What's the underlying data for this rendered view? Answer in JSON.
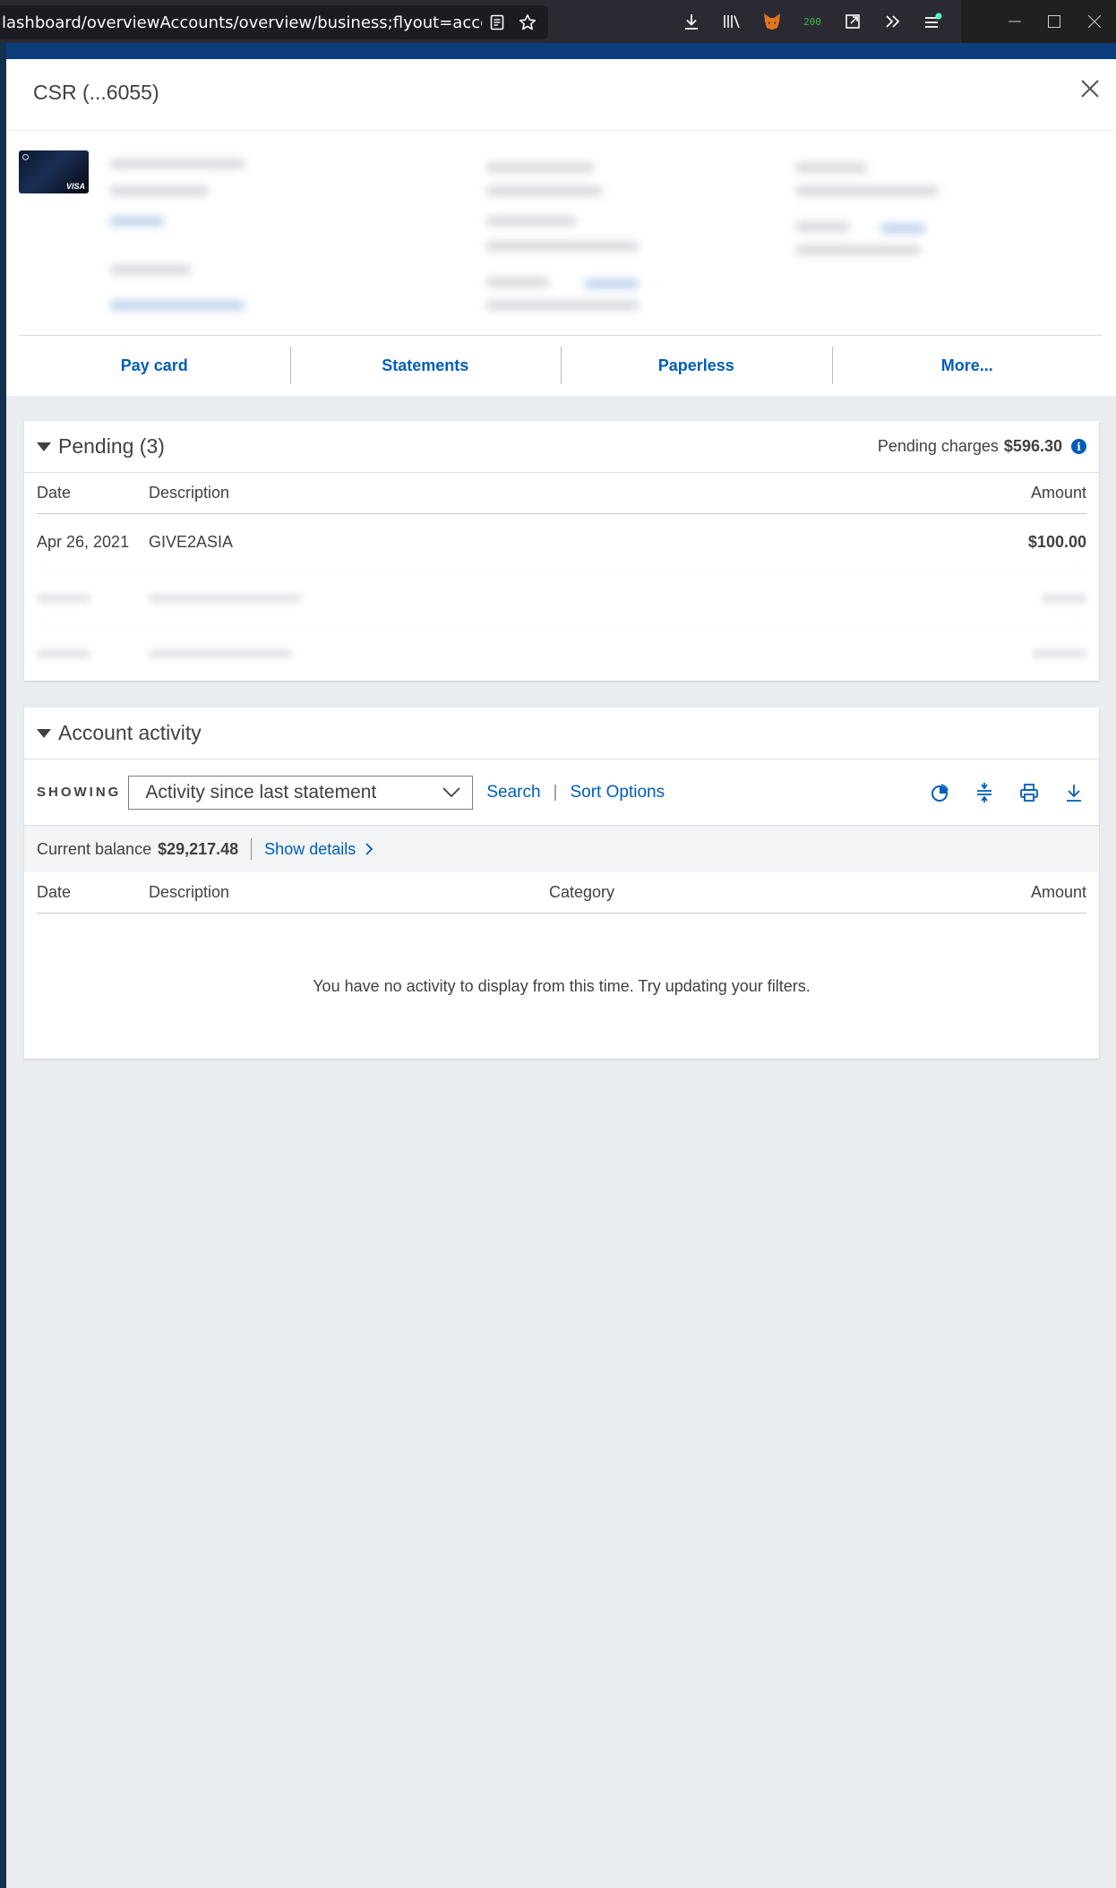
{
  "browser": {
    "url": "lashboard/overviewAccounts/overview/business;flyout=accountSummary",
    "ext_badge": "200"
  },
  "flyout": {
    "title": "CSR (...6055)",
    "card_brand": "VISA"
  },
  "actions": [
    {
      "label": "Pay card"
    },
    {
      "label": "Statements"
    },
    {
      "label": "Paperless"
    },
    {
      "label": "More..."
    }
  ],
  "pending": {
    "title": "Pending (3)",
    "charges_label": "Pending charges",
    "charges_amount": "$596.30",
    "columns": {
      "date": "Date",
      "description": "Description",
      "amount": "Amount"
    },
    "rows": [
      {
        "date": "Apr 26, 2021",
        "description": "GIVE2ASIA",
        "amount": "$100.00"
      }
    ]
  },
  "activity": {
    "title": "Account activity",
    "showing_label": "SHOWING",
    "filter_selected": "Activity since last statement",
    "search_label": "Search",
    "sort_label": "Sort Options",
    "balance_label": "Current balance",
    "balance_amount": "$29,217.48",
    "show_details_label": "Show details",
    "columns": {
      "date": "Date",
      "description": "Description",
      "category": "Category",
      "amount": "Amount"
    },
    "empty_message": "You have no activity to display from this time. Try updating your filters."
  },
  "colors": {
    "link_blue": "#005eb8",
    "navy": "#0b3d7a",
    "background": "#eaedf0"
  }
}
